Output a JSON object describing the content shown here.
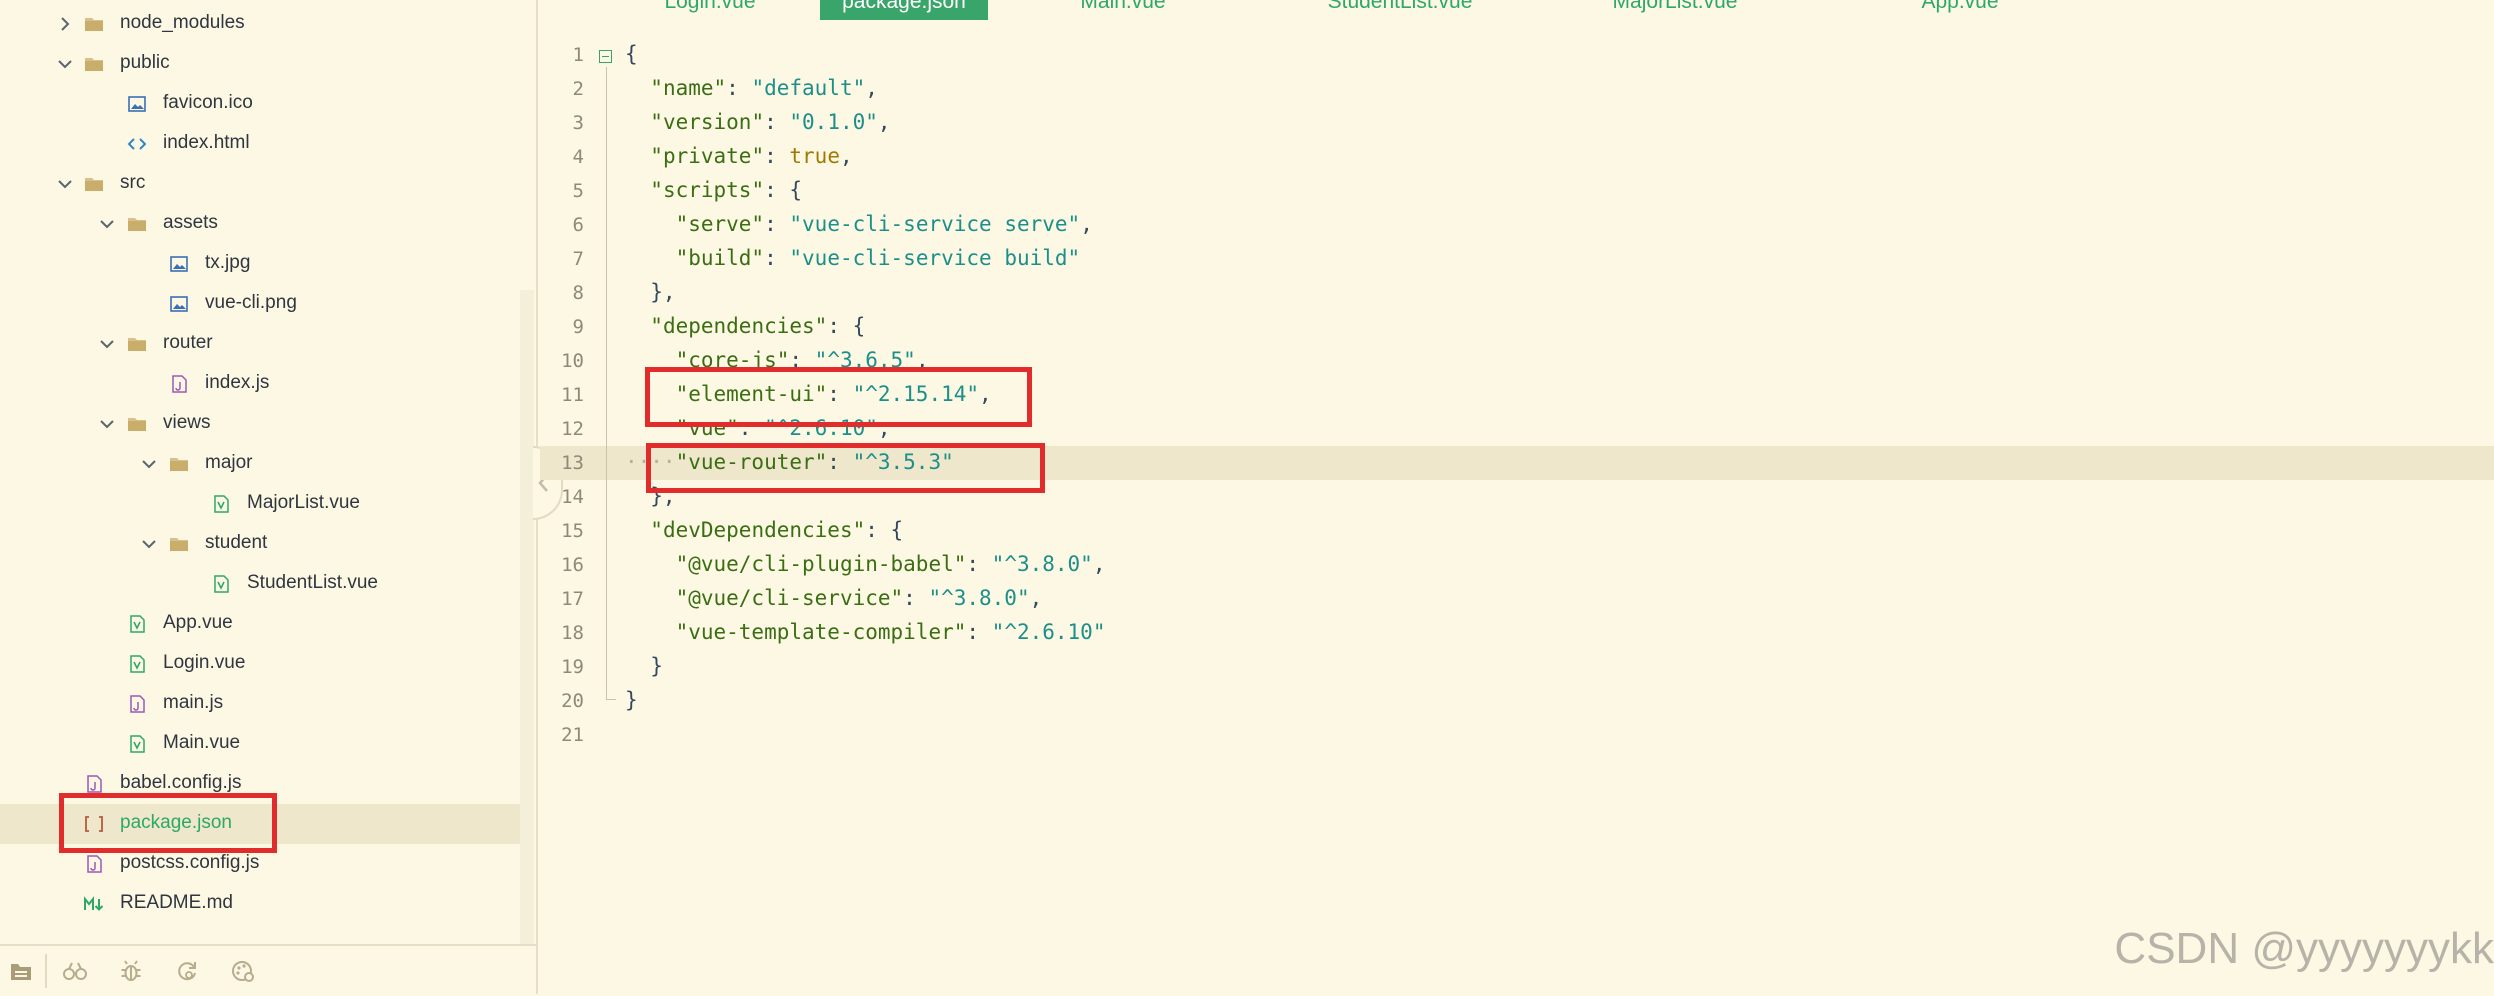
{
  "tabs": [
    {
      "label": "Login.vue",
      "active": false
    },
    {
      "label": "package.json",
      "active": true
    },
    {
      "label": "Main.vue",
      "active": false
    },
    {
      "label": "StudentList.vue",
      "active": false
    },
    {
      "label": "MajorList.vue",
      "active": false
    },
    {
      "label": "App.vue",
      "active": false
    }
  ],
  "tree": [
    {
      "label": "node_modules",
      "type": "folder",
      "expanded": false
    },
    {
      "label": "public",
      "type": "folder",
      "expanded": true
    },
    {
      "label": "favicon.ico",
      "type": "image"
    },
    {
      "label": "index.html",
      "type": "html"
    },
    {
      "label": "src",
      "type": "folder",
      "expanded": true
    },
    {
      "label": "assets",
      "type": "folder",
      "expanded": true
    },
    {
      "label": "tx.jpg",
      "type": "image"
    },
    {
      "label": "vue-cli.png",
      "type": "image"
    },
    {
      "label": "router",
      "type": "folder",
      "expanded": true
    },
    {
      "label": "index.js",
      "type": "js"
    },
    {
      "label": "views",
      "type": "folder",
      "expanded": true
    },
    {
      "label": "major",
      "type": "folder",
      "expanded": true
    },
    {
      "label": "MajorList.vue",
      "type": "vue"
    },
    {
      "label": "student",
      "type": "folder",
      "expanded": true
    },
    {
      "label": "StudentList.vue",
      "type": "vue"
    },
    {
      "label": "App.vue",
      "type": "vue"
    },
    {
      "label": "Login.vue",
      "type": "vue"
    },
    {
      "label": "main.js",
      "type": "js"
    },
    {
      "label": "Main.vue",
      "type": "vue"
    },
    {
      "label": "babel.config.js",
      "type": "js"
    },
    {
      "label": "package.json",
      "type": "json",
      "selected": true
    },
    {
      "label": "postcss.config.js",
      "type": "js"
    },
    {
      "label": "README.md",
      "type": "md"
    }
  ],
  "code_lines": [
    [
      [
        "p",
        "{"
      ]
    ],
    [
      [
        "p",
        "  "
      ],
      [
        "k",
        "\"name\""
      ],
      [
        "p",
        ": "
      ],
      [
        "s",
        "\"default\""
      ],
      [
        "p",
        ","
      ]
    ],
    [
      [
        "p",
        "  "
      ],
      [
        "k",
        "\"version\""
      ],
      [
        "p",
        ": "
      ],
      [
        "s",
        "\"0.1.0\""
      ],
      [
        "p",
        ","
      ]
    ],
    [
      [
        "p",
        "  "
      ],
      [
        "k",
        "\"private\""
      ],
      [
        "p",
        ": "
      ],
      [
        "b",
        "true"
      ],
      [
        "p",
        ","
      ]
    ],
    [
      [
        "p",
        "  "
      ],
      [
        "k",
        "\"scripts\""
      ],
      [
        "p",
        ": {"
      ]
    ],
    [
      [
        "p",
        "    "
      ],
      [
        "k",
        "\"serve\""
      ],
      [
        "p",
        ": "
      ],
      [
        "s",
        "\"vue-cli-service serve\""
      ],
      [
        "p",
        ","
      ]
    ],
    [
      [
        "p",
        "    "
      ],
      [
        "k",
        "\"build\""
      ],
      [
        "p",
        ": "
      ],
      [
        "s",
        "\"vue-cli-service build\""
      ]
    ],
    [
      [
        "p",
        "  },"
      ]
    ],
    [
      [
        "p",
        "  "
      ],
      [
        "k",
        "\"dependencies\""
      ],
      [
        "p",
        ": {"
      ]
    ],
    [
      [
        "p",
        "    "
      ],
      [
        "k",
        "\"core-js\""
      ],
      [
        "p",
        ": "
      ],
      [
        "s",
        "\"^3.6.5\""
      ],
      [
        "p",
        ","
      ]
    ],
    [
      [
        "p",
        "    "
      ],
      [
        "k",
        "\"element-ui\""
      ],
      [
        "p",
        ": "
      ],
      [
        "s",
        "\"^2.15.14\""
      ],
      [
        "p",
        ","
      ]
    ],
    [
      [
        "p",
        "    "
      ],
      [
        "k",
        "\"vue\""
      ],
      [
        "p",
        ": "
      ],
      [
        "s",
        "\"^2.6.10\""
      ],
      [
        "p",
        ","
      ]
    ],
    [
      [
        "ws",
        "····"
      ],
      [
        "k",
        "\"vue-router\""
      ],
      [
        "p",
        ": "
      ],
      [
        "s",
        "\"^3.5.3\""
      ]
    ],
    [
      [
        "p",
        "  },"
      ]
    ],
    [
      [
        "p",
        "  "
      ],
      [
        "k",
        "\"devDependencies\""
      ],
      [
        "p",
        ": {"
      ]
    ],
    [
      [
        "p",
        "    "
      ],
      [
        "k",
        "\"@vue/cli-plugin-babel\""
      ],
      [
        "p",
        ": "
      ],
      [
        "s",
        "\"^3.8.0\""
      ],
      [
        "p",
        ","
      ]
    ],
    [
      [
        "p",
        "    "
      ],
      [
        "k",
        "\"@vue/cli-service\""
      ],
      [
        "p",
        ": "
      ],
      [
        "s",
        "\"^3.8.0\""
      ],
      [
        "p",
        ","
      ]
    ],
    [
      [
        "p",
        "    "
      ],
      [
        "k",
        "\"vue-template-compiler\""
      ],
      [
        "p",
        ": "
      ],
      [
        "s",
        "\"^2.6.10\""
      ]
    ],
    [
      [
        "p",
        "  }"
      ]
    ],
    [
      [
        "p",
        "}"
      ]
    ],
    [
      [
        "p",
        ""
      ]
    ]
  ],
  "current_line": 13,
  "watermark": "CSDN @yyyyyyykk",
  "bottom_icons": [
    "files-icon",
    "binoculars-icon",
    "bug-icon",
    "refresh-search-icon",
    "globe-palette-icon"
  ],
  "colors": {
    "accent": "#3aa56a",
    "highlight_box": "#e22b2b",
    "background": "#fdf8e4"
  }
}
